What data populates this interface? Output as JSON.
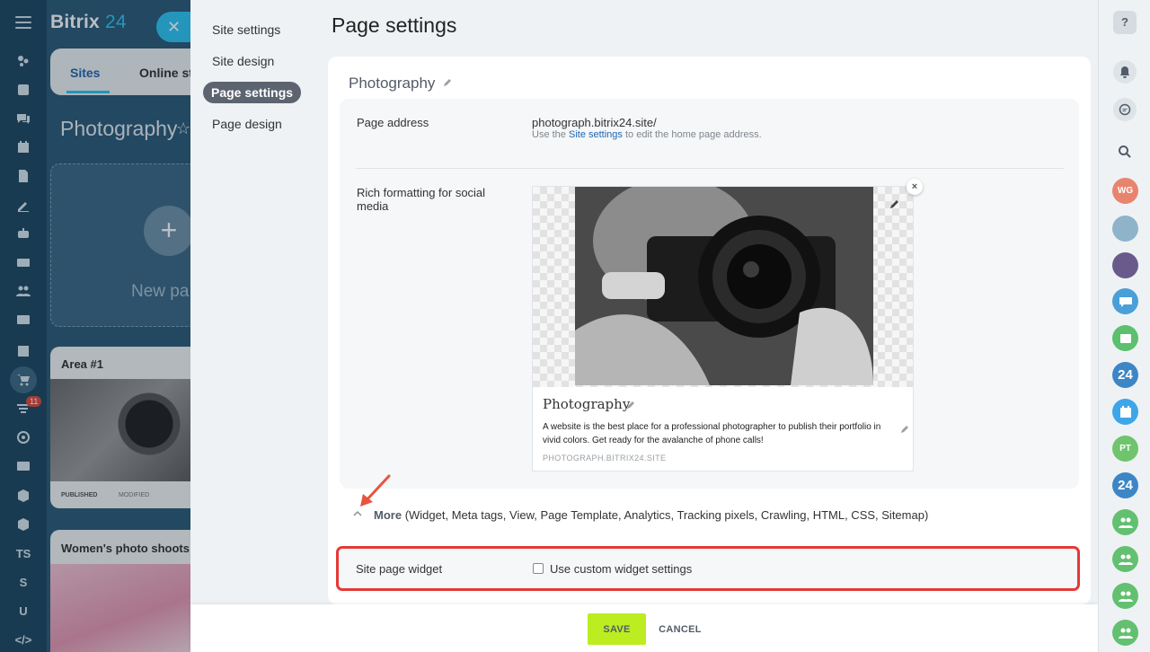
{
  "app": {
    "logo_main": "Bitrix",
    "logo_num": "24"
  },
  "left_rail": {
    "badge": "11",
    "text_items": [
      "TS",
      "S",
      "U",
      "</>"
    ]
  },
  "background_page": {
    "tabs": [
      "Sites",
      "Online st"
    ],
    "title": "Photography",
    "new_page_label": "New pa",
    "cards": [
      {
        "title": "Area #1",
        "status": "PUBLISHED",
        "modified": "MODIFIED"
      },
      {
        "title": "Women's photo shoots"
      }
    ]
  },
  "side_nav": {
    "items": [
      "Site settings",
      "Site design",
      "Page settings",
      "Page design"
    ],
    "active_index": 2
  },
  "panel": {
    "title": "Page settings",
    "page_name": "Photography",
    "page_address": {
      "label": "Page address",
      "value": "photograph.bitrix24.site/",
      "hint_prefix": "Use the",
      "hint_link": "Site settings",
      "hint_suffix": "to edit the home page address."
    },
    "rich_formatting": {
      "label": "Rich formatting for social media",
      "preview_title": "Photography",
      "preview_description": "A website is the best place for a professional photographer to publish their portfolio in vivid colors. Get ready for the avalanche of phone calls!",
      "preview_domain": "PHOTOGRAPH.BITRIX24.SITE",
      "close_symbol": "×"
    },
    "more": {
      "label": "More",
      "details": "(Widget,  Meta tags,  View,  Page Template,  Analytics,  Tracking pixels,  Crawling,  HTML,  CSS,  Sitemap)"
    },
    "widget": {
      "label": "Site page widget",
      "checkbox_label": "Use custom widget settings",
      "checked": false
    }
  },
  "footer": {
    "save": "SAVE",
    "cancel": "CANCEL"
  },
  "right_rail": {
    "help": "?",
    "avatars": [
      {
        "type": "initials",
        "text": "WG",
        "color": "#e8846e"
      },
      {
        "type": "photo",
        "color": "#8fb3c9"
      },
      {
        "type": "photo",
        "color": "#6a5a8c"
      },
      {
        "type": "group-chat",
        "color": "#4a9fd8"
      },
      {
        "type": "icon",
        "color": "#5cc06e"
      },
      {
        "type": "num",
        "text": "24",
        "color": "#3d86c6"
      },
      {
        "type": "calendar",
        "color": "#3ea6e8"
      },
      {
        "type": "initials",
        "text": "PT",
        "color": "#6fc46d"
      },
      {
        "type": "num",
        "text": "24",
        "color": "#3d86c6"
      },
      {
        "type": "group",
        "color": "#63c070"
      },
      {
        "type": "group",
        "color": "#63c070"
      },
      {
        "type": "group",
        "color": "#63c070"
      },
      {
        "type": "group",
        "color": "#63c070"
      }
    ]
  },
  "colors": {
    "accent_link": "#2067b0",
    "save_button": "#bbed21",
    "highlight_border": "#e53935",
    "annotation_arrow": "#e8533f"
  }
}
